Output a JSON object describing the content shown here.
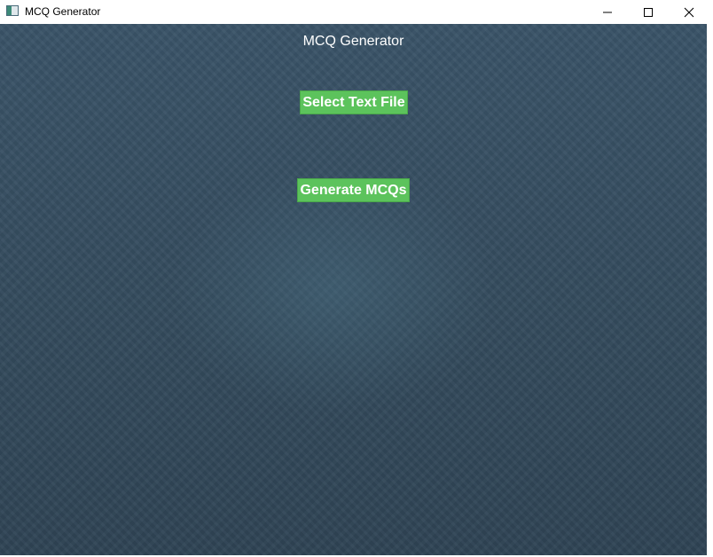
{
  "window": {
    "title": "MCQ Generator",
    "controls": {
      "minimize_icon": "minimize-icon",
      "maximize_icon": "maximize-icon",
      "close_icon": "close-icon"
    }
  },
  "app": {
    "heading": "MCQ Generator",
    "select_button_label": "Select Text File",
    "generate_button_label": "Generate MCQs"
  },
  "colors": {
    "background": "#33495b",
    "button": "#5cc35c",
    "button_text": "#ffffff"
  }
}
